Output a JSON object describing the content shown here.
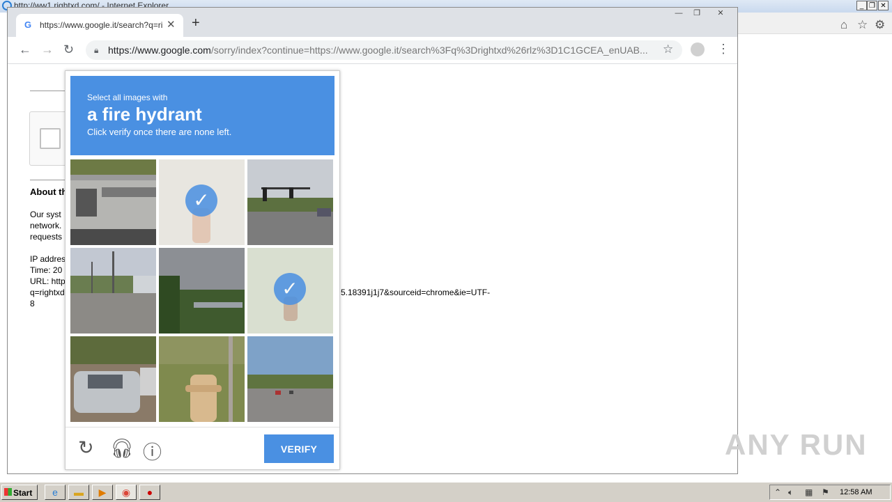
{
  "ie": {
    "title": "http://ww1.rightxd.com/ - Internet Explorer"
  },
  "chrome": {
    "tab_title": "https://www.google.it/search?q=rightxd",
    "url_host": "https://www.google.com",
    "url_path": "/sorry/index?continue=https://www.google.it/search%3Fq%3Drightxd%26rlz%3D1C1GCEA_enUAB..."
  },
  "page": {
    "about_heading": "About th",
    "para1": [
      "Our syst",
      "network.",
      "requests"
    ],
    "ip_label": "IP addres",
    "time_label": "Time: 20",
    "url_label": "URL: http",
    "url_line2": "q=rightxd",
    "url_tail": "5.18391j1j7&sourceid=chrome&ie=UTF-",
    "url_line3": "8"
  },
  "captcha": {
    "line1": "Select all images with",
    "line2": "a fire hydrant",
    "line3": "Click verify once there are none left.",
    "verify_label": "VERIFY",
    "tiles": [
      {
        "selected": false
      },
      {
        "selected": true
      },
      {
        "selected": false
      },
      {
        "selected": false
      },
      {
        "selected": false
      },
      {
        "selected": true
      },
      {
        "selected": false
      },
      {
        "selected": false
      },
      {
        "selected": false
      }
    ]
  },
  "watermark": "ANY RUN",
  "taskbar": {
    "start_label": "Start",
    "clock": "12:58 AM"
  }
}
